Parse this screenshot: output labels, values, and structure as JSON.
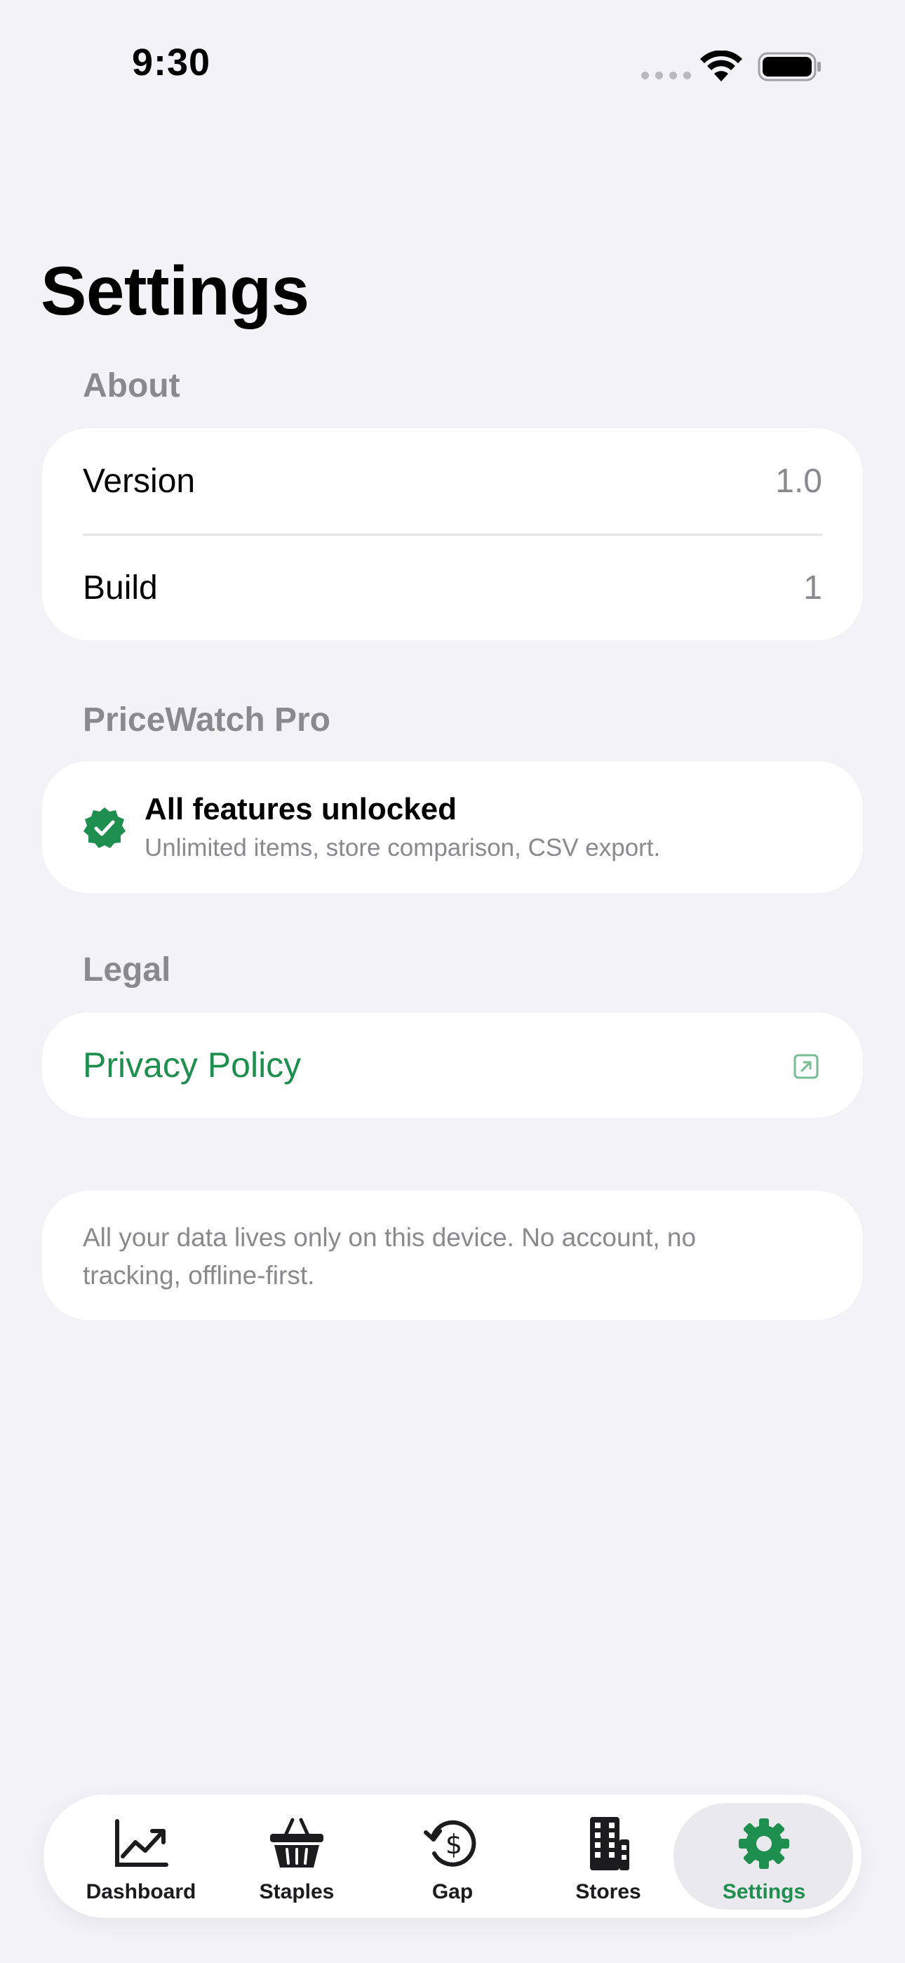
{
  "status_bar": {
    "time": "9:30"
  },
  "page": {
    "title": "Settings"
  },
  "about": {
    "header": "About",
    "rows": [
      {
        "label": "Version",
        "value": "1.0"
      },
      {
        "label": "Build",
        "value": "1"
      }
    ]
  },
  "pro": {
    "header": "PriceWatch Pro",
    "title": "All features unlocked",
    "subtitle": "Unlimited items, store comparison, CSV export."
  },
  "legal": {
    "header": "Legal",
    "privacy_label": "Privacy Policy"
  },
  "note": {
    "text": "All your data lives only on this device. No account, no tracking, offline-first."
  },
  "tabs": [
    {
      "label": "Dashboard",
      "icon": "chart-line-icon"
    },
    {
      "label": "Staples",
      "icon": "basket-icon"
    },
    {
      "label": "Gap",
      "icon": "dollar-cycle-icon"
    },
    {
      "label": "Stores",
      "icon": "building-icon"
    },
    {
      "label": "Settings",
      "icon": "gear-icon",
      "active": true
    }
  ],
  "colors": {
    "accent": "#1e8f4e",
    "background": "#f2f2f7",
    "secondary_text": "#8a8a8e"
  }
}
